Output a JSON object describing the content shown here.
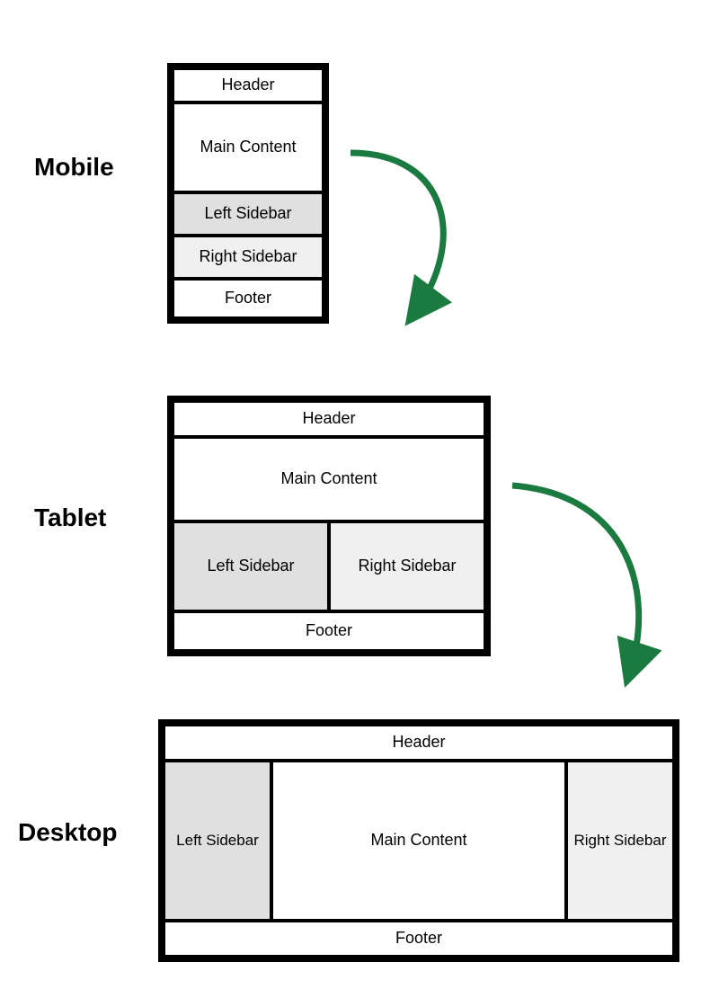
{
  "labels": {
    "mobile": "Mobile",
    "tablet": "Tablet",
    "desktop": "Desktop"
  },
  "regions": {
    "header": "Header",
    "main": "Main Content",
    "left": "Left Sidebar",
    "right": "Right Sidebar",
    "footer": "Footer"
  },
  "colors": {
    "arrow": "#1b7a3f",
    "border": "#000000",
    "shade1": "#e0e0e0",
    "shade2": "#f0f0f0"
  }
}
